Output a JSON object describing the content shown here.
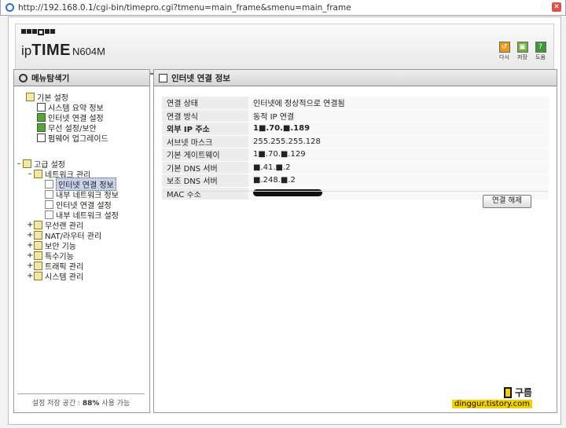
{
  "browser": {
    "url": "http://192.168.0.1/cgi-bin/timepro.cgi?tmenu=main_frame&smenu=main_frame"
  },
  "brand": {
    "ip": "ip",
    "time": "TIME",
    "model": "N604M"
  },
  "header_buttons": [
    {
      "label": "다시",
      "icon": "refresh-icon",
      "color": "#e89a1c"
    },
    {
      "label": "저장",
      "icon": "save-icon",
      "color": "#6fb53a"
    },
    {
      "label": "도움",
      "icon": "help-icon",
      "color": "#3a9a3a"
    }
  ],
  "left_panel": {
    "title": "메뉴탐색기",
    "storage_prefix": "설정 저장 공간 : ",
    "storage_value": "88%",
    "storage_suffix": " 사용 가능"
  },
  "tree": {
    "basic": {
      "label": "기본 설정",
      "items": [
        "시스템 요약 정보",
        "인터넷 연결 설정",
        "무선 설정/보안",
        "펌웨어 업그레이드"
      ]
    },
    "advanced": {
      "label": "고급 설정"
    },
    "network": {
      "label": "네트워크 관리",
      "items": [
        "인터넷 연결 정보",
        "내부 네트워크 정보",
        "인터넷 연결 설정",
        "내부 네트워크 설정"
      ]
    },
    "groups": [
      "무선랜 관리",
      "NAT/라우터 관리",
      "보안 기능",
      "특수기능",
      "트래픽 관리",
      "시스템 관리"
    ]
  },
  "main": {
    "title": "인터넷 연결 정보",
    "rows": [
      {
        "label": "연결 상태",
        "value": "인터넷에 정상적으로 연결됨"
      },
      {
        "label": "연결 방식",
        "value": "동적 IP 연결"
      },
      {
        "label": "외부 IP 주소",
        "value": "1■.70.■.189"
      },
      {
        "label": "서브넷 마스크",
        "value": "255.255.255.128"
      },
      {
        "label": "기본 게이트웨이",
        "value": "1■.70.■.129"
      },
      {
        "label": "기본 DNS 서버",
        "value": "■.41.■.2"
      },
      {
        "label": "보조 DNS 서버",
        "value": "■.248.■.2"
      },
      {
        "label": "MAC 주소",
        "value": ""
      }
    ],
    "disconnect_label": "연결 해제"
  },
  "watermark": {
    "name": "구름",
    "blog": "dinggur.tistory.com"
  }
}
